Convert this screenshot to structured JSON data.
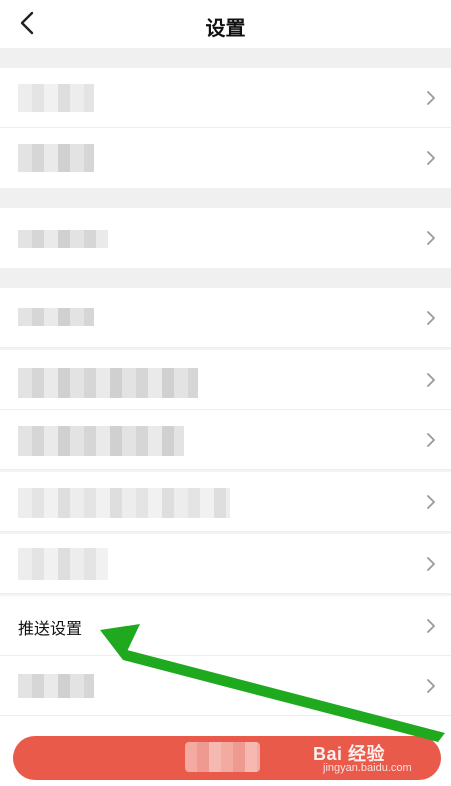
{
  "nav": {
    "title": "设置"
  },
  "rows": {
    "push_settings_label": "推送设置"
  },
  "watermark": {
    "brand": "Bai 经验",
    "site": "jingyan.baidu.com"
  },
  "colors": {
    "arrow_green": "#1fa91f",
    "bottom_button": "#ea5a4a"
  },
  "icons": {
    "back": "back-chevron-icon",
    "row_chevron": "chevron-right-icon"
  }
}
